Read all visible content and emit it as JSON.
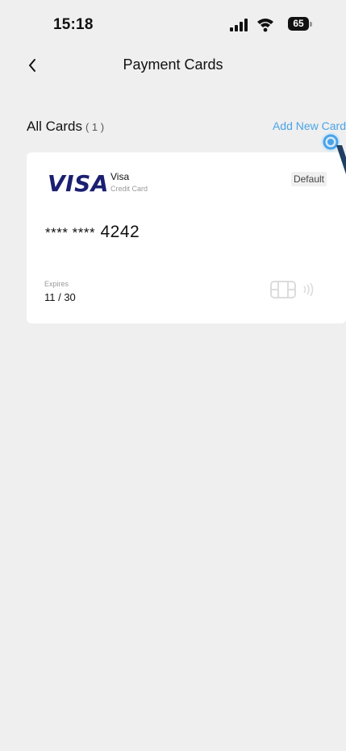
{
  "status_bar": {
    "time": "15:18",
    "battery": "65"
  },
  "header": {
    "back_symbol": "<",
    "title": "Payment Cards"
  },
  "cards_section": {
    "title": "All Cards",
    "count": "( 1 )",
    "add_label": "Add New Card"
  },
  "cards": [
    {
      "logo": "VISA",
      "brand": "Visa",
      "type": "Credit Card",
      "badge": "Default",
      "number_mask": "**** ****",
      "number_last4": "4242",
      "expires_label": "Expires",
      "expires": "11 / 30"
    }
  ],
  "colors": {
    "background": "#efefef",
    "card": "#ffffff",
    "accent": "#4aa3e8",
    "visa_blue": "#1a1f71"
  },
  "icons": {
    "back": "chevron-left-icon",
    "signal": "cellular-signal-icon",
    "wifi": "wifi-icon",
    "battery": "battery-icon",
    "chip": "card-chip-icon",
    "nfc": "contactless-icon",
    "tap": "tap-gesture-icon"
  }
}
